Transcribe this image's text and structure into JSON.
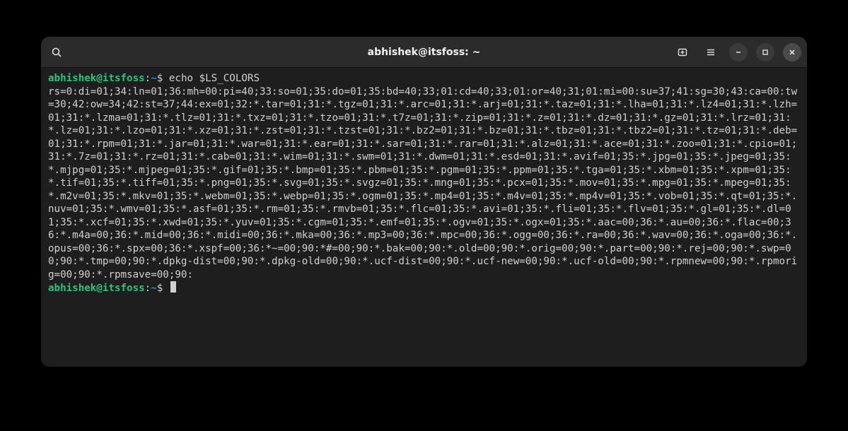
{
  "window": {
    "title": "abhishek@itsfoss: ~"
  },
  "prompt": {
    "user_host": "abhishek@itsfoss",
    "separator": ":",
    "path": "~",
    "symbol": "$"
  },
  "session": {
    "command": "echo $LS_COLORS",
    "output": "rs=0:di=01;34:ln=01;36:mh=00:pi=40;33:so=01;35:do=01;35:bd=40;33;01:cd=40;33;01:or=40;31;01:mi=00:su=37;41:sg=30;43:ca=00:tw=30;42:ow=34;42:st=37;44:ex=01;32:*.tar=01;31:*.tgz=01;31:*.arc=01;31:*.arj=01;31:*.taz=01;31:*.lha=01;31:*.lz4=01;31:*.lzh=01;31:*.lzma=01;31:*.tlz=01;31:*.txz=01;31:*.tzo=01;31:*.t7z=01;31:*.zip=01;31:*.z=01;31:*.dz=01;31:*.gz=01;31:*.lrz=01;31:*.lz=01;31:*.lzo=01;31:*.xz=01;31:*.zst=01;31:*.tzst=01;31:*.bz2=01;31:*.bz=01;31:*.tbz=01;31:*.tbz2=01;31:*.tz=01;31:*.deb=01;31:*.rpm=01;31:*.jar=01;31:*.war=01;31:*.ear=01;31:*.sar=01;31:*.rar=01;31:*.alz=01;31:*.ace=01;31:*.zoo=01;31:*.cpio=01;31:*.7z=01;31:*.rz=01;31:*.cab=01;31:*.wim=01;31:*.swm=01;31:*.dwm=01;31:*.esd=01;31:*.avif=01;35:*.jpg=01;35:*.jpeg=01;35:*.mjpg=01;35:*.mjpeg=01;35:*.gif=01;35:*.bmp=01;35:*.pbm=01;35:*.pgm=01;35:*.ppm=01;35:*.tga=01;35:*.xbm=01;35:*.xpm=01;35:*.tif=01;35:*.tiff=01;35:*.png=01;35:*.svg=01;35:*.svgz=01;35:*.mng=01;35:*.pcx=01;35:*.mov=01;35:*.mpg=01;35:*.mpeg=01;35:*.m2v=01;35:*.mkv=01;35:*.webm=01;35:*.webp=01;35:*.ogm=01;35:*.mp4=01;35:*.m4v=01;35:*.mp4v=01;35:*.vob=01;35:*.qt=01;35:*.nuv=01;35:*.wmv=01;35:*.asf=01;35:*.rm=01;35:*.rmvb=01;35:*.flc=01;35:*.avi=01;35:*.fli=01;35:*.flv=01;35:*.gl=01;35:*.dl=01;35:*.xcf=01;35:*.xwd=01;35:*.yuv=01;35:*.cgm=01;35:*.emf=01;35:*.ogv=01;35:*.ogx=01;35:*.aac=00;36:*.au=00;36:*.flac=00;36:*.m4a=00;36:*.mid=00;36:*.midi=00;36:*.mka=00;36:*.mp3=00;36:*.mpc=00;36:*.ogg=00;36:*.ra=00;36:*.wav=00;36:*.oga=00;36:*.opus=00;36:*.spx=00;36:*.xspf=00;36:*~=00;90:*#=00;90:*.bak=00;90:*.old=00;90:*.orig=00;90:*.part=00;90:*.rej=00;90:*.swp=00;90:*.tmp=00;90:*.dpkg-dist=00;90:*.dpkg-old=00;90:*.ucf-dist=00;90:*.ucf-new=00;90:*.ucf-old=00;90:*.rpmnew=00;90:*.rpmorig=00;90:*.rpmsave=00;90:"
  },
  "icons": {
    "search": "search-icon",
    "new_tab": "new-tab-icon",
    "menu": "hamburger-menu-icon",
    "minimize": "minimize-icon",
    "maximize": "maximize-icon",
    "close": "close-icon"
  }
}
